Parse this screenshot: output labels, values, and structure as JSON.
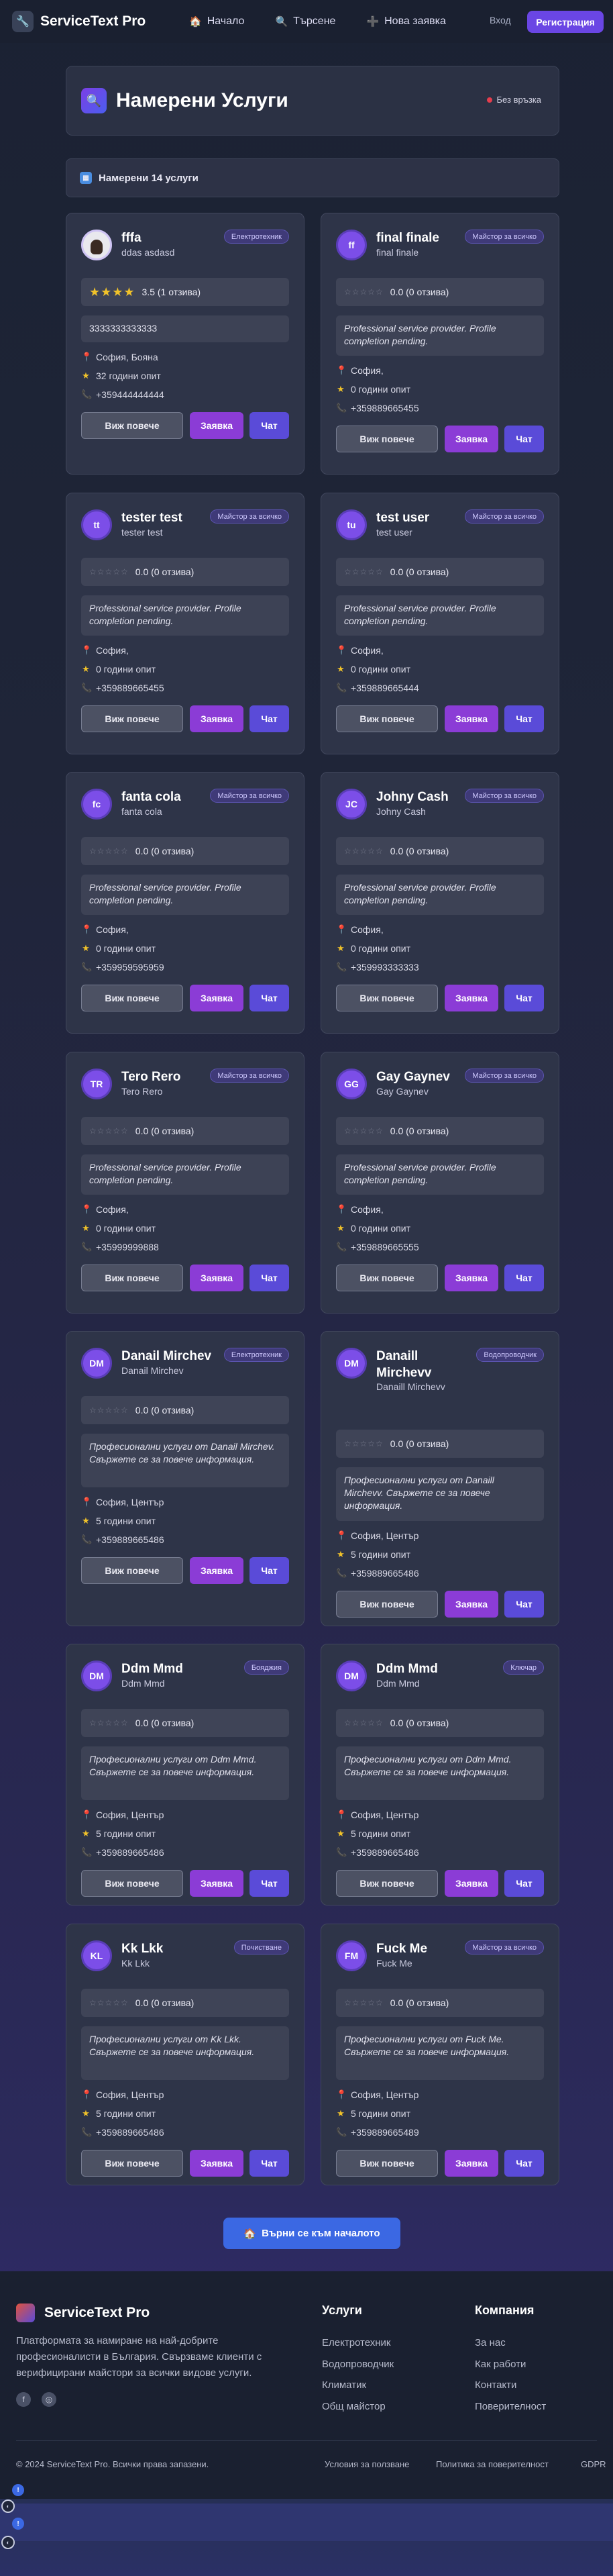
{
  "nav": {
    "brand": "ServiceText Pro",
    "links": [
      {
        "label": "Начало",
        "icon": "🏠"
      },
      {
        "label": "Търсене",
        "icon": "🔍"
      },
      {
        "label": "Нова заявка",
        "icon": "➕"
      }
    ],
    "login": "Вход",
    "register": "Регистрация"
  },
  "header": {
    "title": "Намерени Услуги",
    "status": "Без връзка"
  },
  "results": {
    "count_label": "Намерени 14 услуги"
  },
  "buttons": {
    "more": "Виж повече",
    "request": "Заявка",
    "chat": "Чат"
  },
  "cards": [
    {
      "name": "fffa",
      "sub": "ddas asdasd",
      "badge": "Електротехник",
      "initials": "",
      "photo": true,
      "stars_filled": 4,
      "rating": "3.5 (1 отзива)",
      "desc": "3333333333333",
      "desc_italic": false,
      "location": "София, Бояна",
      "experience": "32 години опит",
      "phone": "+359444444444"
    },
    {
      "name": "final finale",
      "sub": "final finale",
      "badge": "Майстор за всичко",
      "initials": "ff",
      "photo": false,
      "stars_filled": 0,
      "rating": "0.0 (0 отзива)",
      "desc": "Professional service provider. Profile completion pending.",
      "desc_italic": true,
      "location": "София,",
      "experience": "0 години опит",
      "phone": "+359889665455"
    },
    {
      "name": "tester test",
      "sub": "tester test",
      "badge": "Майстор за всичко",
      "initials": "tt",
      "photo": false,
      "stars_filled": 0,
      "rating": "0.0 (0 отзива)",
      "desc": "Professional service provider. Profile completion pending.",
      "desc_italic": true,
      "location": "София,",
      "experience": "0 години опит",
      "phone": "+359889665455"
    },
    {
      "name": "test user",
      "sub": "test user",
      "badge": "Майстор за всичко",
      "initials": "tu",
      "photo": false,
      "stars_filled": 0,
      "rating": "0.0 (0 отзива)",
      "desc": "Professional service provider. Profile completion pending.",
      "desc_italic": true,
      "location": "София,",
      "experience": "0 години опит",
      "phone": "+359889665444"
    },
    {
      "name": "fanta cola",
      "sub": "fanta cola",
      "badge": "Майстор за всичко",
      "initials": "fc",
      "photo": false,
      "stars_filled": 0,
      "rating": "0.0 (0 отзива)",
      "desc": "Professional service provider. Profile completion pending.",
      "desc_italic": true,
      "location": "София,",
      "experience": "0 години опит",
      "phone": "+359959595959"
    },
    {
      "name": "Johny Cash",
      "sub": "Johny Cash",
      "badge": "Майстор за всичко",
      "initials": "JC",
      "photo": false,
      "stars_filled": 0,
      "rating": "0.0 (0 отзива)",
      "desc": "Professional service provider. Profile completion pending.",
      "desc_italic": true,
      "location": "София,",
      "experience": "0 години опит",
      "phone": "+359993333333"
    },
    {
      "name": "Tero Rero",
      "sub": "Tero Rero",
      "badge": "Майстор за всичко",
      "initials": "TR",
      "photo": false,
      "stars_filled": 0,
      "rating": "0.0 (0 отзива)",
      "desc": "Professional service provider. Profile completion pending.",
      "desc_italic": true,
      "location": "София,",
      "experience": "0 години опит",
      "phone": "+35999999888"
    },
    {
      "name": "Gay Gaynev",
      "sub": "Gay Gaynev",
      "badge": "Майстор за всичко",
      "initials": "GG",
      "photo": false,
      "stars_filled": 0,
      "rating": "0.0 (0 отзива)",
      "desc": "Professional service provider. Profile completion pending.",
      "desc_italic": true,
      "location": "София,",
      "experience": "0 години опит",
      "phone": "+359889665555"
    },
    {
      "name": "Danail Mirchev",
      "sub": "Danail Mirchev",
      "badge": "Електротехник",
      "initials": "DM",
      "photo": false,
      "stars_filled": 0,
      "rating": "0.0 (0 отзива)",
      "desc": "Професионални услуги от Danail Mirchev. Свържете се за повече информация.",
      "desc_italic": true,
      "location": "София, Център",
      "experience": "5 години опит",
      "phone": "+359889665486"
    },
    {
      "name": "Danaill Mirchevv",
      "sub": "Danaill Mirchevv",
      "badge": "Водопроводчик",
      "initials": "DM",
      "photo": false,
      "stars_filled": 0,
      "rating": "0.0 (0 отзива)",
      "desc": "Професионални услуги от Danaill Mirchevv. Свържете се за повече информация.",
      "desc_italic": true,
      "location": "София, Център",
      "experience": "5 години опит",
      "phone": "+359889665486"
    },
    {
      "name": "Ddm Mmd",
      "sub": "Ddm Mmd",
      "badge": "Бояджия",
      "initials": "DM",
      "photo": false,
      "stars_filled": 0,
      "rating": "0.0 (0 отзива)",
      "desc": "Професионални услуги от Ddm Mmd. Свържете се за повече информация.",
      "desc_italic": true,
      "location": "София, Център",
      "experience": "5 години опит",
      "phone": "+359889665486"
    },
    {
      "name": "Ddm Mmd",
      "sub": "Ddm Mmd",
      "badge": "Ключар",
      "initials": "DM",
      "photo": false,
      "stars_filled": 0,
      "rating": "0.0 (0 отзива)",
      "desc": "Професионални услуги от Ddm Mmd. Свържете се за повече информация.",
      "desc_italic": true,
      "location": "София, Център",
      "experience": "5 години опит",
      "phone": "+359889665486"
    },
    {
      "name": "Kk Lkk",
      "sub": "Kk Lkk",
      "badge": "Почистване",
      "initials": "KL",
      "photo": false,
      "stars_filled": 0,
      "rating": "0.0 (0 отзива)",
      "desc": "Професионални услуги от Kk Lkk. Свържете се за повече информация.",
      "desc_italic": true,
      "location": "София, Център",
      "experience": "5 години опит",
      "phone": "+359889665486"
    },
    {
      "name": "Fuck Me",
      "sub": "Fuck Me",
      "badge": "Майстор за всичко",
      "initials": "FM",
      "photo": false,
      "stars_filled": 0,
      "rating": "0.0 (0 отзива)",
      "desc": "Професионални услуги от Fuck Me. Свържете се за повече информация.",
      "desc_italic": true,
      "location": "София, Център",
      "experience": "5 години опит",
      "phone": "+359889665489"
    }
  ],
  "home_button": {
    "label": "Върни се към началото",
    "icon": "🏠"
  },
  "footer": {
    "brand": "ServiceText Pro",
    "about": "Платформата за намиране на най-добрите професионалисти в България. Свързваме клиенти с верифицирани майстори за всички видове услуги.",
    "services_title": "Услуги",
    "services": [
      "Електротехник",
      "Водопроводчик",
      "Климатик",
      "Общ майстор"
    ],
    "company_title": "Компания",
    "company": [
      "За нас",
      "Как работи",
      "Контакти",
      "Поверителност"
    ],
    "copyright": "© 2024 ServiceText Pro. Всички права запазени.",
    "legal": [
      "Условия за ползване",
      "Политика за поверителност",
      "GDPR"
    ]
  },
  "floating": {
    "badge_1": "!",
    "badge_2": "!"
  }
}
